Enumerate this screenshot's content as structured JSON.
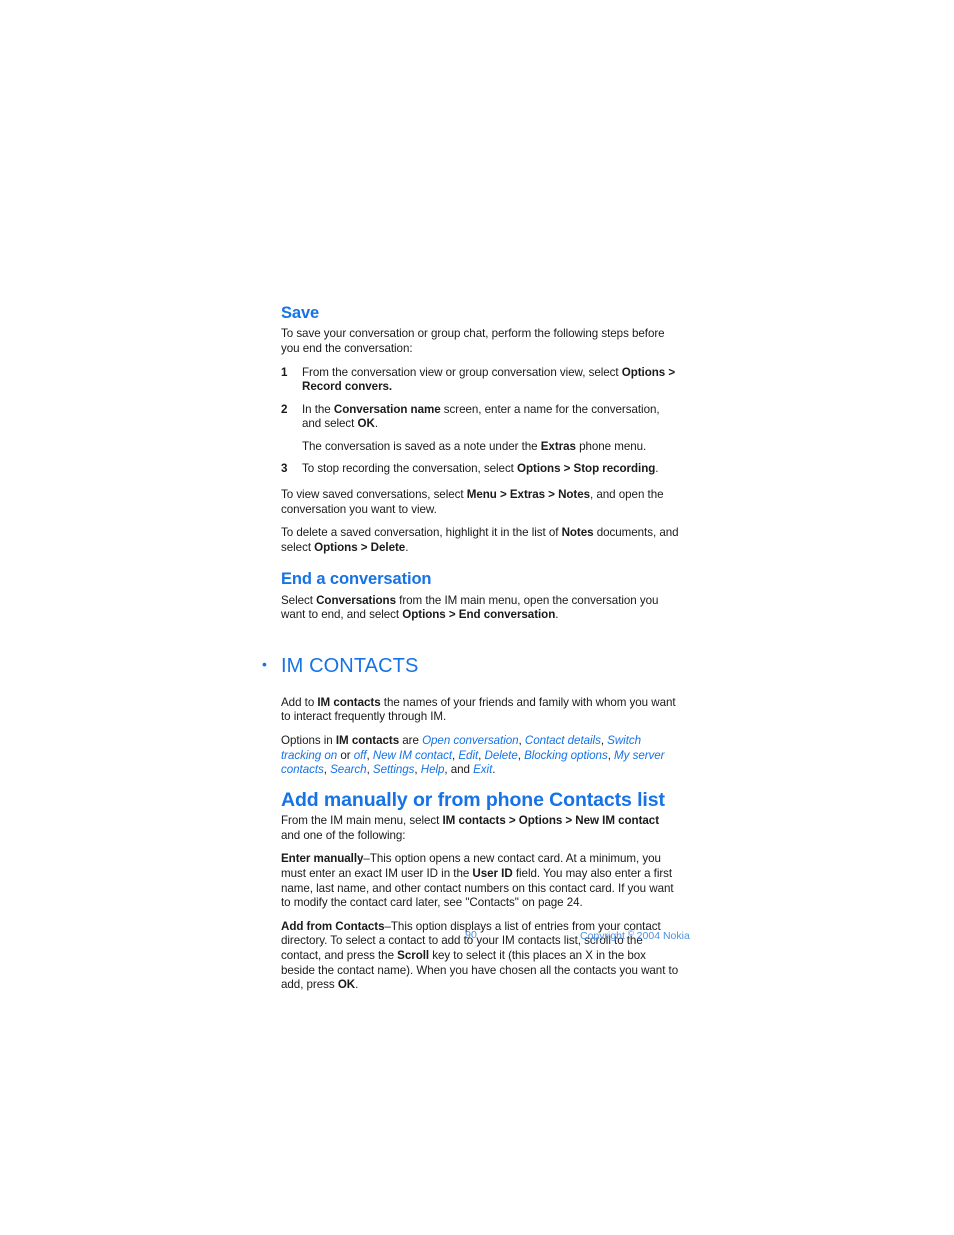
{
  "document": {
    "page_number": "90",
    "copyright_prefix": "Copyright ",
    "copyright_symbol": "©",
    "copyright_suffix": " 2004 Nokia",
    "heading_color": "#1673e6",
    "body_color": "#1a1a1a",
    "footer_color": "#4a90e2"
  },
  "sections": {
    "save": {
      "heading": "Save",
      "intro": {
        "text": "To save your conversation or group chat, perform the following steps before you end the conversation:"
      },
      "steps": [
        {
          "num": "1",
          "part1": "From the conversation view or group conversation view, select ",
          "bold1": "Options > Record convers.",
          "part2": ""
        },
        {
          "num": "2",
          "part1": "In the ",
          "bold1": "Conversation name",
          "part2": " screen, enter a name for the conversation, and select ",
          "bold2": "OK",
          "part3": "."
        },
        {
          "num": "3",
          "part1": "To stop recording the conversation, select ",
          "bold1": "Options > Stop recording",
          "part2": "."
        }
      ],
      "step2_note": {
        "part1": "The conversation is saved as a note under the ",
        "bold1": "Extras",
        "part2": " phone menu."
      },
      "view_saved": {
        "part1": "To view saved conversations, select ",
        "bold1": "Menu > Extras > Notes",
        "part2": ", and open the conversation you want to view."
      },
      "delete_saved": {
        "part1": "To delete a saved conversation, highlight it in the list of ",
        "bold1": "Notes",
        "part2": " documents, and select ",
        "bold2": "Options > Delete",
        "part3": "."
      }
    },
    "end_conversation": {
      "heading": "End a conversation",
      "body": {
        "part1": "Select ",
        "bold1": "Conversations",
        "part2": " from the IM main menu, open the conversation you want to end, and select ",
        "bold2": "Options > End conversation",
        "part3": "."
      }
    },
    "im_contacts": {
      "bullet": "•",
      "heading": "IM CONTACTS",
      "intro": {
        "part1": "Add to ",
        "bold1": "IM contacts",
        "part2": " the names of your friends and family with whom you want to interact frequently through IM."
      },
      "options_line": {
        "part1": "Options in ",
        "bold1": "IM contacts",
        "part2": " are ",
        "options": [
          "Open conversation",
          "Contact details",
          "Switch tracking on",
          "off",
          "New IM contact",
          "Edit",
          "Delete",
          "Blocking options",
          "My server contacts",
          "Search",
          "Settings",
          "Help",
          "Exit"
        ],
        "conjunction_or": " or ",
        "conjunction_and": ", and ",
        "terminator": "."
      },
      "add_manually": {
        "heading": "Add manually or from phone Contacts list",
        "intro": {
          "part1": "From the IM main menu, select ",
          "bold1": "IM contacts > Options > New IM contact",
          "part2": " and one of the following:"
        },
        "enter_manually": {
          "bold1": "Enter manually",
          "part1": "–This option opens a new contact card. At a minimum, you must enter an exact IM user ID in the ",
          "bold2": "User ID",
          "part2": " field. You may also enter a first name, last name, and other contact numbers on this contact card. If you want to modify the contact card later, see \"Contacts\" on page 24."
        },
        "add_from_contacts": {
          "bold1": "Add from Contacts",
          "part1": "–This option displays a list of entries from your contact directory. To select a contact to add to your IM contacts list, scroll to the contact, and press the ",
          "bold2": "Scroll",
          "part2": " key to select it (this places an X in the box beside the contact name). When you have chosen all the contacts you want to add, press ",
          "bold3": "OK",
          "part3": "."
        }
      }
    }
  }
}
